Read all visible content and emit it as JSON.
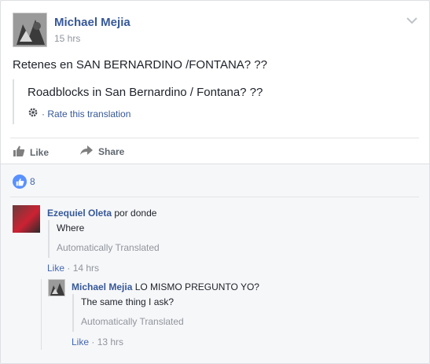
{
  "post": {
    "author": "Michael Mejia",
    "time": "15 hrs",
    "text": "Retenes en SAN BERNARDINO /FONTANA? ??",
    "translation": "Roadblocks in San Bernardino / Fontana? ??",
    "rate_translation": "· Rate this translation"
  },
  "actions": {
    "like": "Like",
    "share": "Share"
  },
  "reactions": {
    "count": "8"
  },
  "comments": [
    {
      "author": "Ezequiel Oleta",
      "text": "por donde",
      "translation": "Where",
      "auto_label": "Automatically Translated",
      "like": "Like",
      "time": "· 14 hrs",
      "reply": {
        "author": "Michael Mejia",
        "text": "LO MISMO PREGUNTO YO?",
        "translation": "The same thing I ask?",
        "auto_label": "Automatically Translated",
        "like": "Like",
        "time": "· 13 hrs"
      }
    }
  ],
  "colors": {
    "link": "#365899",
    "muted": "#90949c",
    "like_blue": "#5890ff"
  }
}
